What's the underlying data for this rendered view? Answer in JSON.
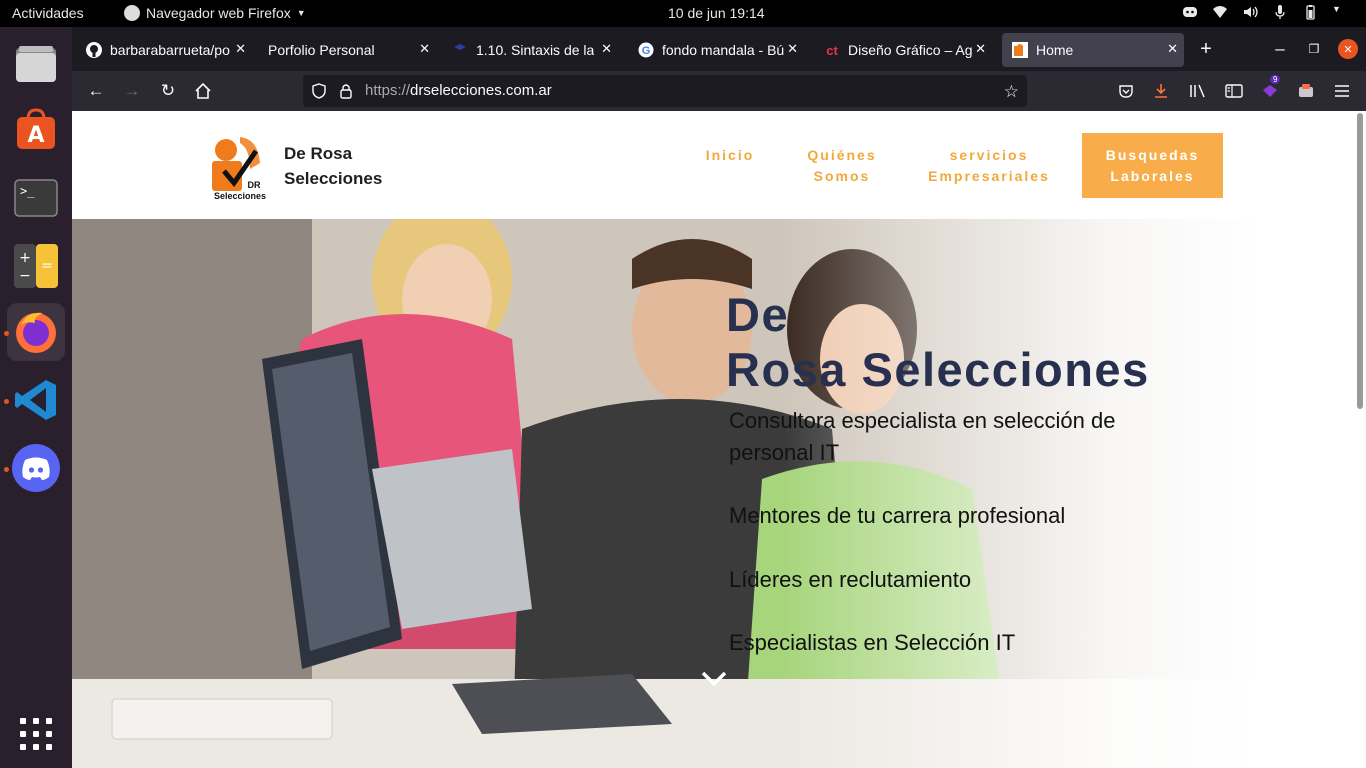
{
  "topbar": {
    "activities": "Actividades",
    "app_name": "Navegador web Firefox",
    "clock": "10 de jun  19:14"
  },
  "dock": {
    "items": [
      "files-icon",
      "software-icon",
      "terminal-icon",
      "calculator-icon",
      "firefox-icon",
      "vscode-icon",
      "discord-icon",
      "app-grid-icon"
    ]
  },
  "tabs": [
    {
      "title": "barbarabarrueta/po",
      "icon": "github-icon"
    },
    {
      "title": "Porfolio Personal",
      "icon": "none"
    },
    {
      "title": "1.10. Sintaxis de la",
      "icon": "doc-icon"
    },
    {
      "title": "fondo mandala - Bú",
      "icon": "google-icon"
    },
    {
      "title": "Diseño Gráfico – Ag",
      "icon": "ct-icon"
    },
    {
      "title": "Home",
      "icon": "site-icon"
    }
  ],
  "navbar": {
    "url_protocol": "https://",
    "url_host": "drselecciones.com.ar",
    "extension_badge": "9"
  },
  "site": {
    "brand_line1": "De Rosa",
    "brand_line2": "Selecciones",
    "logo_text1": "DR",
    "logo_text2": "Selecciones",
    "nav": [
      {
        "line1": "Inicio",
        "line2": ""
      },
      {
        "line1": "Quiénes",
        "line2": "Somos"
      },
      {
        "line1": "servicios",
        "line2": "Empresariales"
      }
    ],
    "cta_line1": "Busquedas",
    "cta_line2": "Laborales"
  },
  "hero": {
    "title_line1": "De",
    "title_line2": "Rosa Selecciones",
    "lines": [
      "Consultora especialista en  selección de",
      "personal IT",
      "Mentores de tu carrera profesional",
      "Líderes en reclutamiento",
      "Especialistas en Selección IT"
    ]
  },
  "colors": {
    "accent": "#f8ad4a",
    "nav_text": "#f0a93a",
    "hero_title": "#27304e",
    "ubuntu_orange": "#e95420"
  }
}
